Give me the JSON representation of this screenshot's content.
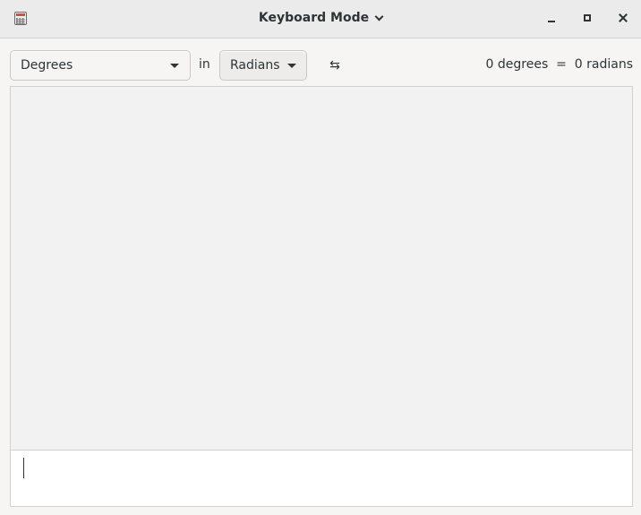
{
  "window": {
    "title": "Keyboard Mode",
    "controls": [
      "minimize",
      "maximize",
      "close"
    ]
  },
  "converter": {
    "from_unit": "Degrees",
    "in_label": "in",
    "to_unit": "Radians",
    "swap_icon": "⇆",
    "result_text": "0 degrees  =  0 radians"
  },
  "icons": {
    "app": "calculator-icon",
    "title_menu": "chevron-down-icon",
    "swap": "swap-arrows-icon"
  },
  "input": {
    "value": ""
  }
}
